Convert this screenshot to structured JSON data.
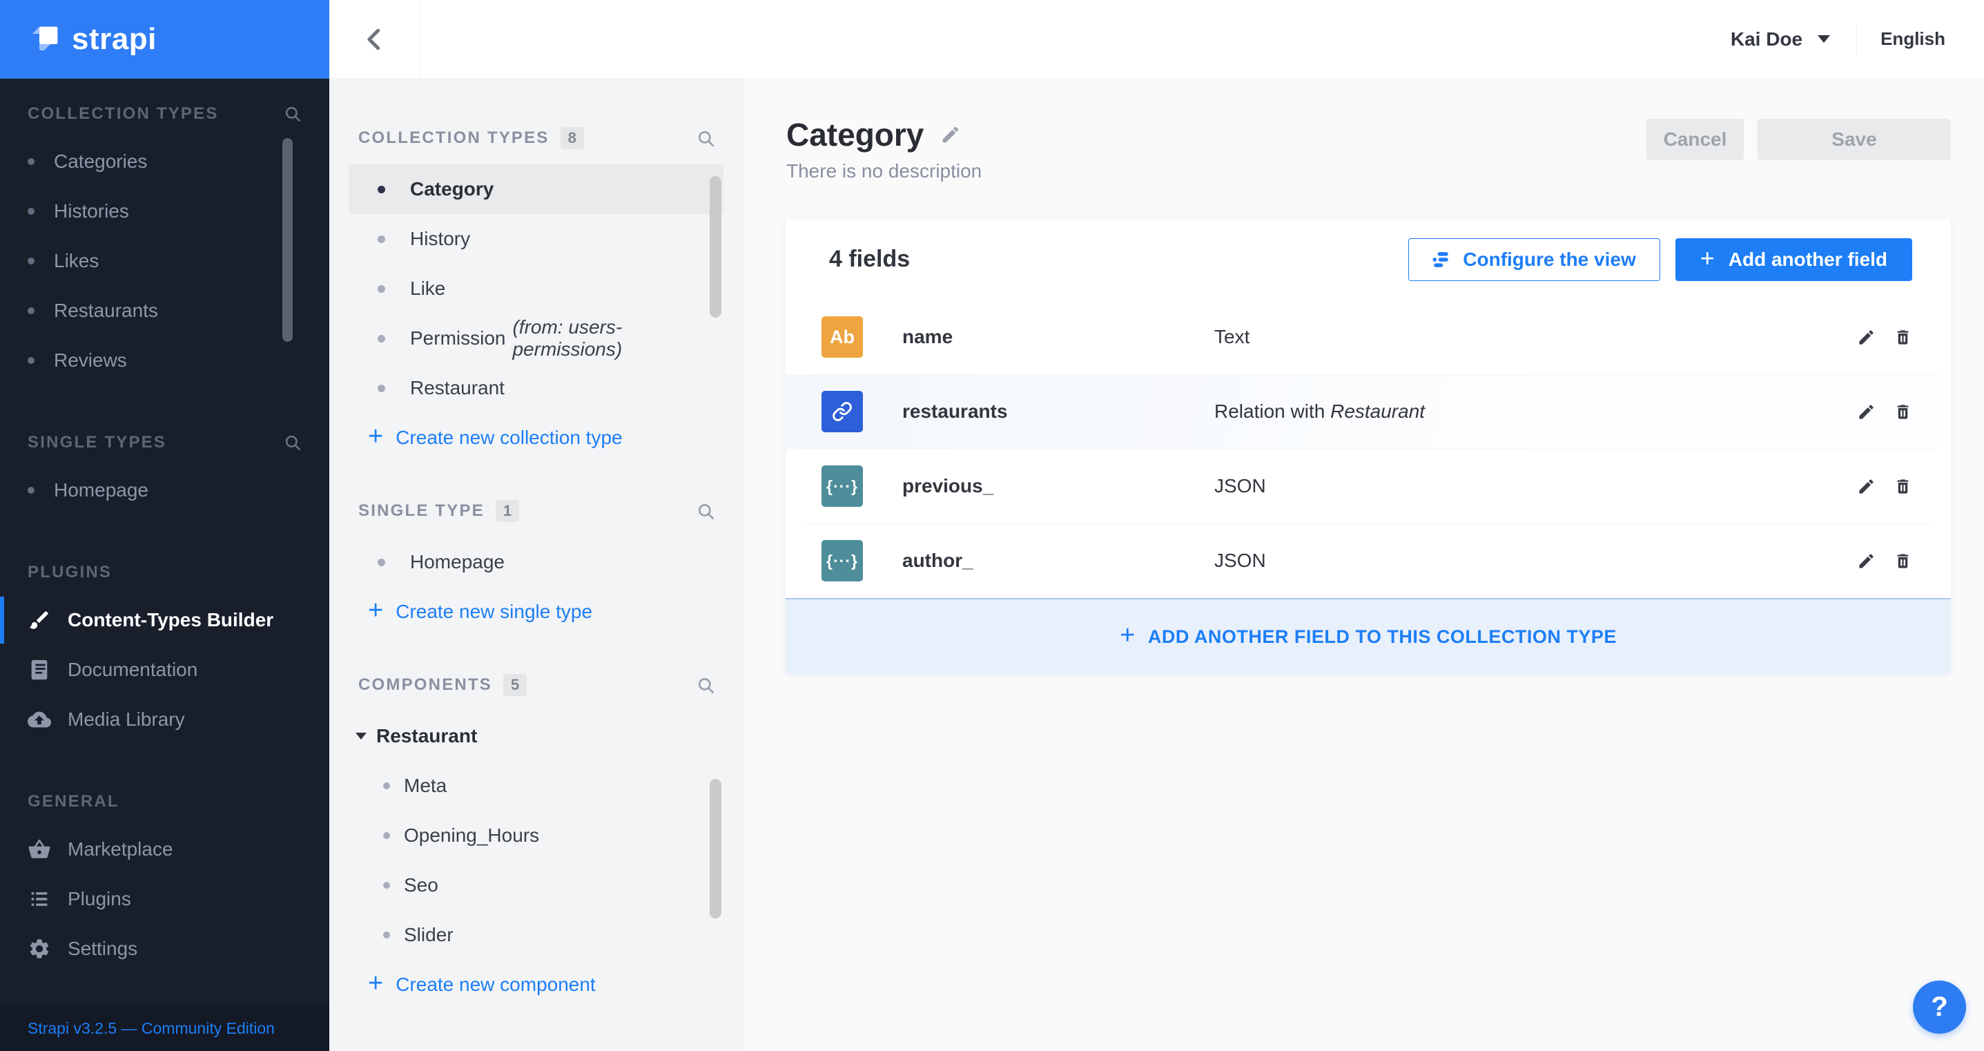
{
  "app": {
    "logo": "strapi",
    "version": "Strapi v3.2.5 — Community Edition"
  },
  "topbar": {
    "user": "Kai Doe",
    "locale": "English"
  },
  "sidenav": {
    "collection_label": "COLLECTION TYPES",
    "collection_items": [
      "Categories",
      "Histories",
      "Likes",
      "Restaurants",
      "Reviews"
    ],
    "single_label": "SINGLE TYPES",
    "single_items": [
      "Homepage"
    ],
    "plugins_label": "PLUGINS",
    "plugins_items": [
      {
        "label": "Content-Types Builder",
        "icon": "paintbrush-icon",
        "active": true
      },
      {
        "label": "Documentation",
        "icon": "book-icon"
      },
      {
        "label": "Media Library",
        "icon": "cloud-upload-icon"
      }
    ],
    "general_label": "GENERAL",
    "general_items": [
      {
        "label": "Marketplace",
        "icon": "basket-icon"
      },
      {
        "label": "Plugins",
        "icon": "list-icon"
      },
      {
        "label": "Settings",
        "icon": "gear-icon"
      }
    ]
  },
  "subnav": {
    "collection": {
      "label": "COLLECTION TYPES",
      "count": "8",
      "items": [
        {
          "label": "Category",
          "active": true
        },
        {
          "label": "History"
        },
        {
          "label": "Like"
        },
        {
          "label": "Permission",
          "note": "(from: users-permissions)"
        },
        {
          "label": "Restaurant"
        }
      ],
      "create": "Create new collection type"
    },
    "single": {
      "label": "SINGLE TYPE",
      "count": "1",
      "items": [
        {
          "label": "Homepage"
        }
      ],
      "create": "Create new single type"
    },
    "components": {
      "label": "COMPONENTS",
      "count": "5",
      "group": "Restaurant",
      "items": [
        {
          "label": "Meta"
        },
        {
          "label": "Opening_Hours"
        },
        {
          "label": "Seo"
        },
        {
          "label": "Slider"
        }
      ],
      "create": "Create new component"
    }
  },
  "page": {
    "title": "Category",
    "description": "There is no description",
    "cancel": "Cancel",
    "save": "Save"
  },
  "fields": {
    "summary": "4 fields",
    "configure": "Configure the view",
    "add_field": "Add another field",
    "rows": [
      {
        "icon": "text-field-icon",
        "badge": "Ab",
        "name": "name",
        "type": "Text"
      },
      {
        "icon": "relation-field-icon",
        "badge": "",
        "name": "restaurants",
        "type": "Relation with",
        "type_em": "Restaurant"
      },
      {
        "icon": "json-field-icon",
        "badge": "{···}",
        "name": "previous_",
        "type": "JSON"
      },
      {
        "icon": "json-field-icon",
        "badge": "{···}",
        "name": "author_",
        "type": "JSON"
      }
    ],
    "banner": "ADD ANOTHER FIELD TO THIS COLLECTION TYPE"
  },
  "help": {
    "label": "?"
  },
  "colors": {
    "accent": "#1D7EF6",
    "header_blue": "#2E7CF6",
    "sidebar_dark": "#191E2B",
    "text_field_icon": "#EFA53F",
    "relation_field_icon": "#2D5FD9",
    "json_field_icon": "#4E8D9A"
  }
}
